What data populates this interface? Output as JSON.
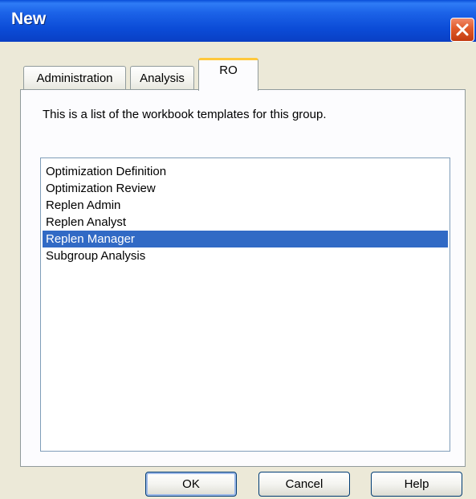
{
  "window": {
    "title": "New",
    "close_icon": "close-icon"
  },
  "tabs": [
    {
      "label": "Administration",
      "active": false
    },
    {
      "label": "Analysis",
      "active": false
    },
    {
      "label": "RO",
      "active": true
    }
  ],
  "content": {
    "description": "This is a list of the workbook templates for this group.",
    "templates": [
      {
        "label": "Optimization Definition",
        "selected": false
      },
      {
        "label": "Optimization Review",
        "selected": false
      },
      {
        "label": "Replen Admin",
        "selected": false
      },
      {
        "label": "Replen Analyst",
        "selected": false
      },
      {
        "label": "Replen Manager",
        "selected": true
      },
      {
        "label": "Subgroup Analysis",
        "selected": false
      }
    ]
  },
  "buttons": {
    "ok": "OK",
    "cancel": "Cancel",
    "help": "Help"
  },
  "colors": {
    "titlebar": "#0a4fd9",
    "selection": "#316ac5",
    "active_tab_accent": "#ffc83c",
    "close_button": "#e05a2a"
  }
}
